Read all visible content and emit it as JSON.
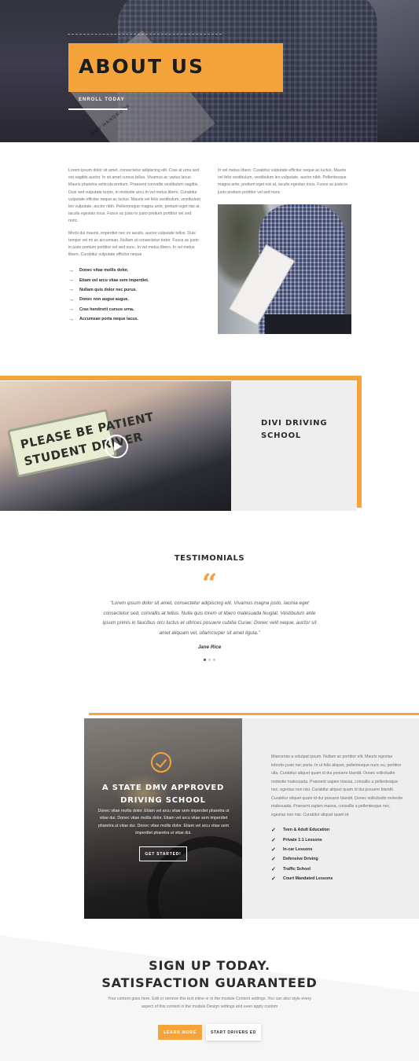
{
  "hero": {
    "title": "ABOUT US",
    "enroll_link": "ENROLL TODAY",
    "handbook_text": "DMV HANDBOOK"
  },
  "about": {
    "left_paragraphs": [
      "Lorem ipsum dolor sit amet, consectetur adipiscing elit. Cras at urna sed est sagittis auctor. In sit amet cursus tellus. Vivamus ac varius lacus. Mauris pharetra vehicula pretium. Praesent convallis vestibulum sagittis. Duis sed vulputate turpis, in molestie arcu.In vel metus libero. Curabitur vulputate efficitur neque ac luctus. Mauris vel felis vestibulum, vestibulum leo vulputate, auctor nibh. Pellentesque magna ante, pretium eget nisi at, iaculis egestas risus. Fusce ac justo in justo pretium porttitor vel sed nunc.",
      "Morbi dui mauris, imperdiet nec ex iaculis, auctor vulputate tellus. Duis tempor vel mi ac accumsan. Nullam ut consectetur tortor. Fusce ac justo in justo pretium porttitor vel sed nunc. In vel metus libero. In vel metus libero. Curabitur vulputate efficitur neque"
    ],
    "right_paragraph": "In vel metus libero. Curabitur vulputate efficitur neque ac luctus. Mauris vel felis vestibulum, vestibulum leo vulputate, auctor nibh. Pellentesque magna ante, pretium eget nisi at, iaculis egestas risus. Fusce ac justo in justo pretium porttitor vel sed nunc.",
    "bullets": [
      "Donec vitae mollis dolor.",
      "Etiam vel arcu vitae sem imperdiet.",
      "Nullam quis dolor nec purus.",
      "Donec non augue augue.",
      "Cras hendrerit cursus urna.",
      "Accumsan porta neque lacus."
    ],
    "bullet_icon": "arrow-right-icon"
  },
  "video": {
    "sign_line1": "PLEASE BE PATIENT",
    "sign_line2": "STUDENT DRIVER",
    "school_title": "DIVI DRIVING SCHOOL"
  },
  "testimonials": {
    "heading": "TESTIMONIALS",
    "quote_mark": "“",
    "text": "“Lorem ipsum dolor sit amet, consectetur adipiscing elit. Vivamus magna justo, lacinia eget consectetur sed, convallis at tellus. Nulla quis lorem ut libero malesuada feugiat. Vestibulum ante ipsum primis in faucibus orci luctus et ultrices posuere cubilia Curae; Donec velit neque, auctor sit amet aliquam vel, ullamcorper sit amet ligula.”",
    "author": "Jane Rice"
  },
  "dmv": {
    "title": "A STATE DMV APPROVED DRIVING SCHOOL",
    "body": "Donec vitae mollis dolor. Etiam vel arcu vitae sem imperdiet pharetra ut vitae dui. Donec vitae mollis dolor. Etiam vel arcu vitae sem imperdiet pharetra ut vitae dui. Donec vitae mollis dolor. Etiam vel arcu vitae sem imperdiet pharetra ut vitae dui.",
    "button": "GET STARTED!",
    "text": "Maecenas a volutpat ipsum. Nullam ac porttitor elit. Mauris egestas lobortis justo nec porta. In ut felis aliquet, pellentesque nunc eu, porttitor ulla. Curabitur aliquet quam id dui posuere blandit. Donec sollicitudin molestie malesuada. Praesent sapien massa, convallis a pellentesque nec, egestas non nisi. Curabitur aliquet quam id dui posuere blandit. Curabitur aliquet quam id dui posuere blandit. Donec sollicitudin molestie malesuada. Praesent sapien massa, convallis a pellentesque nec, egestas non nisi. Curabitur aliquet quam id",
    "features": [
      "Teen & Adult Education",
      "Private 1:1 Lessons",
      "In-car Lessons",
      "Defensive Driving",
      "Traffic School",
      "Court Mandated Lessons"
    ],
    "check_icon": "checkmark-icon"
  },
  "signup": {
    "title_line1": "SIGN UP TODAY.",
    "title_line2": "SATISFACTION GUARANTEED",
    "text": "Your content goes here. Edit or remove this text inline or in the module Content settings. You can also style every aspect of this content in the module Design settings and even apply custom",
    "learn_more": "LEARN MORE",
    "start_drivers_ed": "START DRIVERS ED"
  },
  "colors": {
    "accent": "#f5a43c",
    "panel": "#eeeeee",
    "heading": "#2b2b2b"
  }
}
